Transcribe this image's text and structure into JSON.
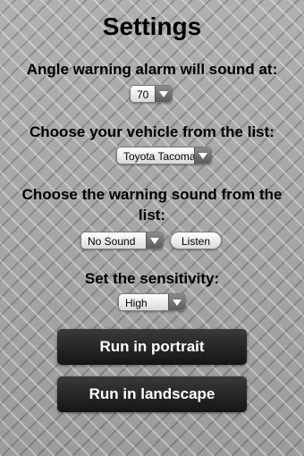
{
  "title": "Settings",
  "angle": {
    "label": "Angle warning alarm will sound at:",
    "value": "70"
  },
  "vehicle": {
    "label": "Choose your vehicle from the list:",
    "value": "Toyota Tacoma"
  },
  "sound": {
    "label_line1": "Choose the warning sound from the",
    "label_line2": "list:",
    "value": "No Sound",
    "listen_label": "Listen"
  },
  "sensitivity": {
    "label": "Set the sensitivity:",
    "value": "High"
  },
  "buttons": {
    "portrait": "Run in portrait",
    "landscape": "Run in landscape"
  },
  "colors": {
    "background": "#a4a4a4",
    "button_bg": "#1e1e1e",
    "button_text": "#ffffff"
  },
  "icons": {
    "dropdown": "chevron-down-icon"
  }
}
